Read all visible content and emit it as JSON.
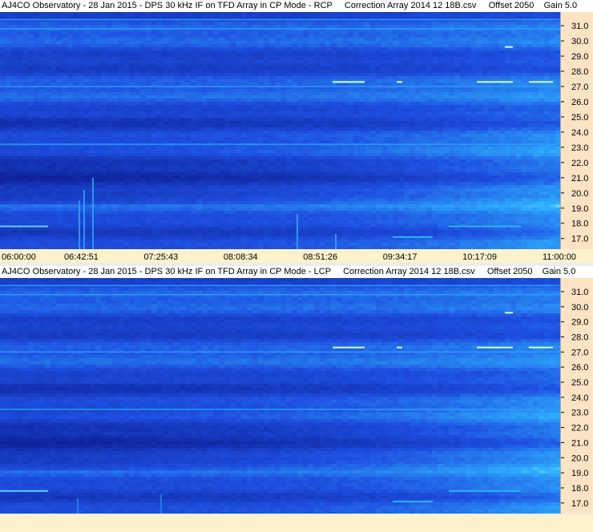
{
  "panels": [
    {
      "title": "AJ4CO Observatory - 28 Jan 2015 - DPS 30 kHz IF on TFD Array in CP Mode - RCP     Correction Array 2014 12 18B.csv     Offset 2050    Gain 5.0",
      "polarization": "RCP"
    },
    {
      "title": "AJ4CO Observatory - 28 Jan 2015 - DPS 30 kHz IF on TFD Array in CP Mode - LCP     Correction Array 2014 12 18B.csv     Offset 2050    Gain 5.0",
      "polarization": "LCP"
    }
  ],
  "chart_data": [
    {
      "type": "heatmap",
      "title": "AJ4CO Observatory - 28 Jan 2015 - DPS 30 kHz IF on TFD Array in CP Mode - RCP",
      "x_ticks": [
        "06:00:00",
        "06:42:51",
        "07:25:43",
        "08:08:34",
        "08:51:26",
        "09:34:17",
        "10:17:09",
        "11:00:00"
      ],
      "y_ticks": [
        "17.0",
        "18.0",
        "19.0",
        "20.0",
        "21.0",
        "22.0",
        "23.0",
        "24.0",
        "25.0",
        "26.0",
        "27.0",
        "28.0",
        "29.0",
        "30.0",
        "31.0"
      ],
      "ylim": [
        16.3,
        31.9
      ],
      "xlim": [
        "06:00:00",
        "11:00:00"
      ],
      "colors": {
        "low": "#0a1a8c",
        "mid": "#1e4fe0",
        "high": "#2fb4ff",
        "peak": "#cfffe0"
      }
    },
    {
      "type": "heatmap",
      "title": "AJ4CO Observatory - 28 Jan 2015 - DPS 30 kHz IF on TFD Array in CP Mode - LCP",
      "x_ticks": [],
      "y_ticks": [
        "17.0",
        "18.0",
        "19.0",
        "20.0",
        "21.0",
        "22.0",
        "23.0",
        "24.0",
        "25.0",
        "26.0",
        "27.0",
        "28.0",
        "29.0",
        "30.0",
        "31.0"
      ],
      "ylim": [
        16.3,
        31.9
      ],
      "xlim": [
        "06:00:00",
        "11:00:00"
      ],
      "colors": {
        "low": "#0a1a8c",
        "mid": "#1e4fe0",
        "high": "#2fb4ff",
        "peak": "#cfffe0"
      }
    }
  ]
}
